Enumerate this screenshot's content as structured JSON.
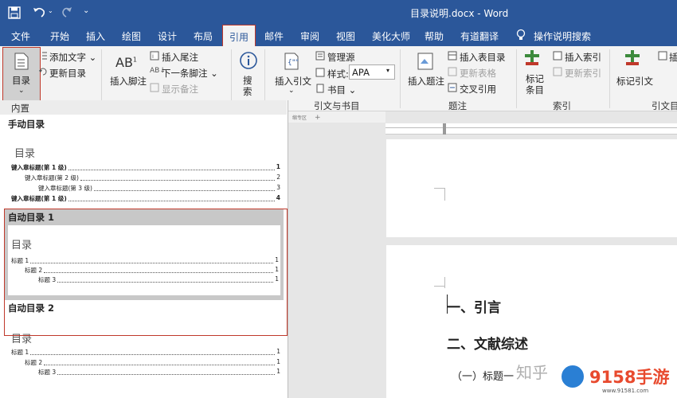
{
  "window": {
    "title": "目录说明.docx - Word"
  },
  "quick_access": {
    "save": "save-icon",
    "undo": "undo-icon",
    "redo": "redo-icon",
    "customize": "customize-icon"
  },
  "menu": {
    "tabs": [
      "文件",
      "开始",
      "插入",
      "绘图",
      "设计",
      "布局",
      "引用",
      "邮件",
      "审阅",
      "视图",
      "美化大师",
      "帮助",
      "有道翻译"
    ],
    "active": "引用",
    "tell_me": "操作说明搜索"
  },
  "ribbon": {
    "toc_button": "目录",
    "add_text": "添加文字",
    "update_toc": "更新目录",
    "insert_footnote": "插入脚注",
    "insert_endnote": "插入尾注",
    "next_footnote": "下一条脚注",
    "show_notes": "显示备注",
    "search": "搜\n索",
    "insert_citation": "插入引文",
    "manage_sources": "管理源",
    "style_label": "样式:",
    "style_value": "APA",
    "bibliography": "书目",
    "group_citations": "引文与书目",
    "insert_caption": "插入题注",
    "insert_table_of_figures": "插入表目录",
    "update_table": "更新表格",
    "cross_reference": "交叉引用",
    "group_captions": "题注",
    "mark_entry": "标记\n条目",
    "insert_index": "插入索引",
    "update_index": "更新索引",
    "group_index": "索引",
    "mark_citation": "标记引文",
    "group_toa": "引文目",
    "insert_toa": "插"
  },
  "toc_gallery": {
    "section": "内置",
    "manual": {
      "label": "手动目录",
      "title": "目录",
      "lines": [
        {
          "text": "键入章标题(第 1 级)",
          "page": "1"
        },
        {
          "text": "键入章标题(第 2 级)",
          "page": "2"
        },
        {
          "text": "键入章标题(第 3 级)",
          "page": "3"
        },
        {
          "text": "键入章标题(第 1 级)",
          "page": "4"
        }
      ]
    },
    "auto1": {
      "label": "自动目录 1",
      "title": "目录",
      "lines": [
        {
          "text": "标题 1",
          "page": "1"
        },
        {
          "text": "标题 2",
          "page": "1"
        },
        {
          "text": "标题 3",
          "page": "1"
        }
      ]
    },
    "auto2": {
      "label": "自动目录 2",
      "title": "目录",
      "lines": [
        {
          "text": "标题 1",
          "page": "1"
        },
        {
          "text": "标题 2",
          "page": "1"
        },
        {
          "text": "标题 3",
          "page": "1"
        }
      ]
    }
  },
  "document": {
    "tab_strip": "缩专区",
    "headings": [
      "一、引言",
      "二、文献综述"
    ],
    "subheading": "（一）标题一"
  },
  "watermark": {
    "zhihu": "知乎",
    "site": "9158手游",
    "url": "www.91581.com"
  }
}
